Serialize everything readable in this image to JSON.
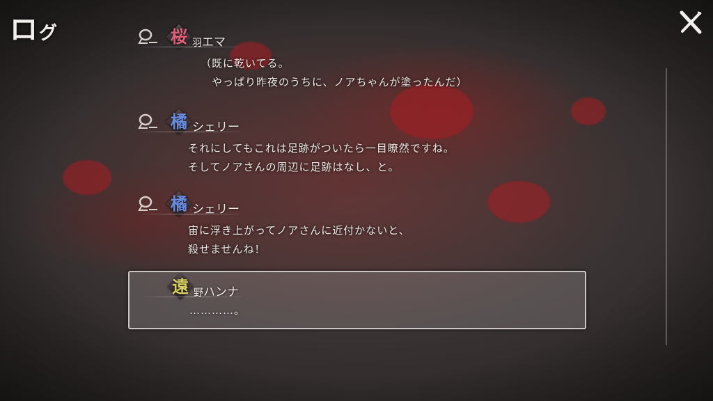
{
  "title": {
    "main": "ロ",
    "small": "グ"
  },
  "close": {
    "icon": "close-x-icon"
  },
  "entries": [
    {
      "kanji": "桜",
      "kanji_color": "#e0607a",
      "name_rest": "羽",
      "name_kana": "エマ",
      "lines": [
        "（既に乾いてる。",
        "　やっぱり昨夜のうちに、ノアちゃんが塗ったんだ）"
      ],
      "highlight": false
    },
    {
      "kanji": "橘",
      "kanji_color": "#6a8ce0",
      "name_rest": "",
      "name_kana": "シェリー",
      "lines": [
        "それにしてもこれは足跡がついたら一目瞭然ですね。",
        "そしてノアさんの周辺に足跡はなし、と。"
      ],
      "highlight": false
    },
    {
      "kanji": "橘",
      "kanji_color": "#6a8ce0",
      "name_rest": "",
      "name_kana": "シェリー",
      "lines": [
        "宙に浮き上がってノアさんに近付かないと、",
        "殺せませんね！"
      ],
      "highlight": false
    },
    {
      "kanji": "遠",
      "kanji_color": "#d8d060",
      "name_rest": "野",
      "name_kana": "ハンナ",
      "lines": [
        "…………。"
      ],
      "highlight": true
    }
  ]
}
